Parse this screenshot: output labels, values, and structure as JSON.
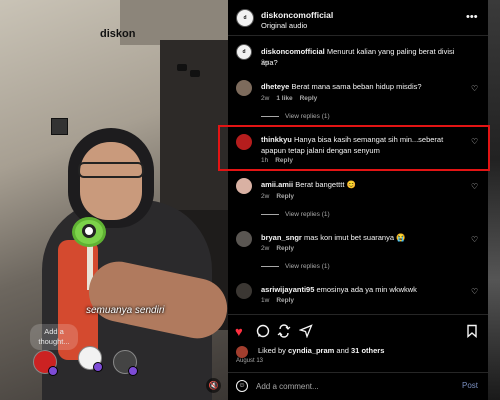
{
  "video": {
    "watermark_brand": "diskon",
    "caption": "semuanya sendiri",
    "thought_prompt": "Add a thought...",
    "mute_icon": "speaker-muted-icon"
  },
  "header": {
    "username": "diskoncomofficial",
    "audio": "Original audio",
    "more_icon": "more-horizontal-icon"
  },
  "caption_post": {
    "username": "diskoncomofficial",
    "text": "Menurut kalian yang paling berat divisi apa?",
    "time": "2w"
  },
  "comments": [
    {
      "username": "dheteye",
      "text": "Berat mana sama beban hidup misdis?",
      "time": "2w",
      "likes": "1 like",
      "reply": "Reply",
      "view_replies": "View replies (1)"
    },
    {
      "username": "thinkkyu",
      "text": "Hanya bisa kasih semangat sih min...seberat apapun tetap jalani dengan senyum",
      "time": "1h",
      "likes": "",
      "reply": "Reply",
      "view_replies": ""
    },
    {
      "username": "amii.amii",
      "text": "Berat bangetttt 😊",
      "time": "2w",
      "likes": "",
      "reply": "Reply",
      "view_replies": "View replies (1)"
    },
    {
      "username": "bryan_sngr",
      "text": "mas kon imut bet suaranya 😭",
      "time": "2w",
      "likes": "",
      "reply": "Reply",
      "view_replies": "View replies (1)"
    },
    {
      "username": "asriwijayanti95",
      "text": "emosinya ada ya min wkwkwk",
      "time": "1w",
      "likes": "",
      "reply": "Reply",
      "view_replies": ""
    }
  ],
  "actions": {
    "liked_prefix": "Liked by",
    "liked_user": "cyndia_pram",
    "liked_joiner": "and",
    "liked_others": "31 others",
    "date": "August 13"
  },
  "add_comment": {
    "placeholder": "Add a comment...",
    "post_label": "Post"
  },
  "colors": {
    "highlight": "#e31414",
    "like_red": "#ff3040",
    "post_blue": "#7a8fbf"
  }
}
